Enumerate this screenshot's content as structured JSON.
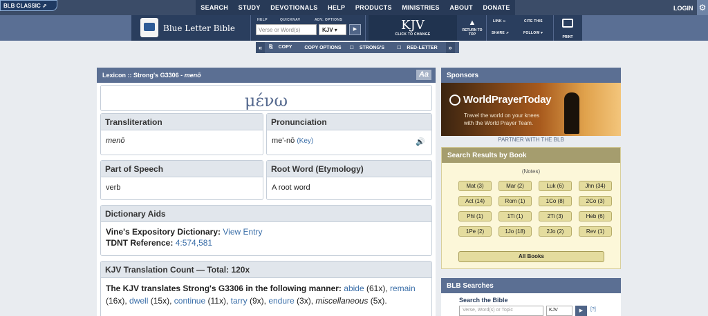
{
  "topnav": {
    "classic": "BLB CLASSIC",
    "items": [
      "SEARCH",
      "STUDY",
      "DEVOTIONALS",
      "HELP",
      "PRODUCTS",
      "MINISTRIES",
      "ABOUT",
      "DONATE"
    ],
    "login": "LOGIN"
  },
  "header": {
    "brand": "Blue Letter Bible",
    "help_label": "HELP",
    "quicknav_label": "QUICKNAV",
    "adv_label": "ADV. OPTIONS",
    "verse_placeholder": "Verse or Word(s)",
    "version": "KJV",
    "kjv_big": "KJV",
    "click_change": "CLICK TO CHANGE",
    "return_top": "RETURN TO TOP",
    "link": "LINK",
    "cite": "CITE THIS",
    "share": "SHARE",
    "follow": "FOLLOW",
    "print": "PRINT"
  },
  "toolbar": {
    "copy": "COPY",
    "copy_options": "COPY OPTIONS",
    "strongs": "STRONG'S",
    "red_letter": "RED-LETTER"
  },
  "lexicon": {
    "title_prefix": "Lexicon :: Strong's G3306 - ",
    "title_word": "menō",
    "aa": "Aa",
    "greek": "μένω",
    "translit_label": "Transliteration",
    "translit_value": "menō",
    "pron_label": "Pronunciation",
    "pron_value": "me'-nō",
    "pron_key": "(Key)",
    "pos_label": "Part of Speech",
    "pos_value": "verb",
    "root_label": "Root Word (Etymology)",
    "root_value": "A root word",
    "dict_label": "Dictionary Aids",
    "vines_label": "Vine's Expository Dictionary:",
    "vines_link": "View Entry",
    "tdnt_label": "TDNT Reference:",
    "tdnt_link": "4:574,581",
    "count_label": "KJV Translation Count — Total: 120x",
    "translates_text": "The KJV translates Strong's G3306 in the following manner:",
    "renderings": [
      "abide",
      "(61x),",
      "remain",
      "(16x),",
      "dwell",
      "(15x),",
      "continue",
      "(11x),",
      "tarry",
      "(9x),",
      "endure",
      "(3x),",
      "miscellaneous",
      "(5x)."
    ]
  },
  "sidebar": {
    "sponsors": "Sponsors",
    "ad_title": "WorldPrayerToday",
    "ad_text1": "Travel the world on your knees",
    "ad_text2": "with the World Prayer Team.",
    "partner": "PARTNER WITH THE BLB",
    "results_title": "Search Results by Book",
    "notes": "(Notes)",
    "books": [
      "Mat (3)",
      "Mar (2)",
      "Luk (6)",
      "Jhn (34)",
      "Act (14)",
      "Rom (1)",
      "1Co (8)",
      "2Co (3)",
      "Phl (1)",
      "1Ti (1)",
      "2Ti (3)",
      "Heb (6)",
      "1Pe (2)",
      "1Jo (18)",
      "2Jo (2)",
      "Rev (1)"
    ],
    "all_books": "All Books",
    "blb_searches": "BLB Searches",
    "search_bible": "Search the Bible",
    "search_placeholder": "Verse, Word(s) or Topic",
    "search_version": "KJV",
    "q": "[?]"
  }
}
